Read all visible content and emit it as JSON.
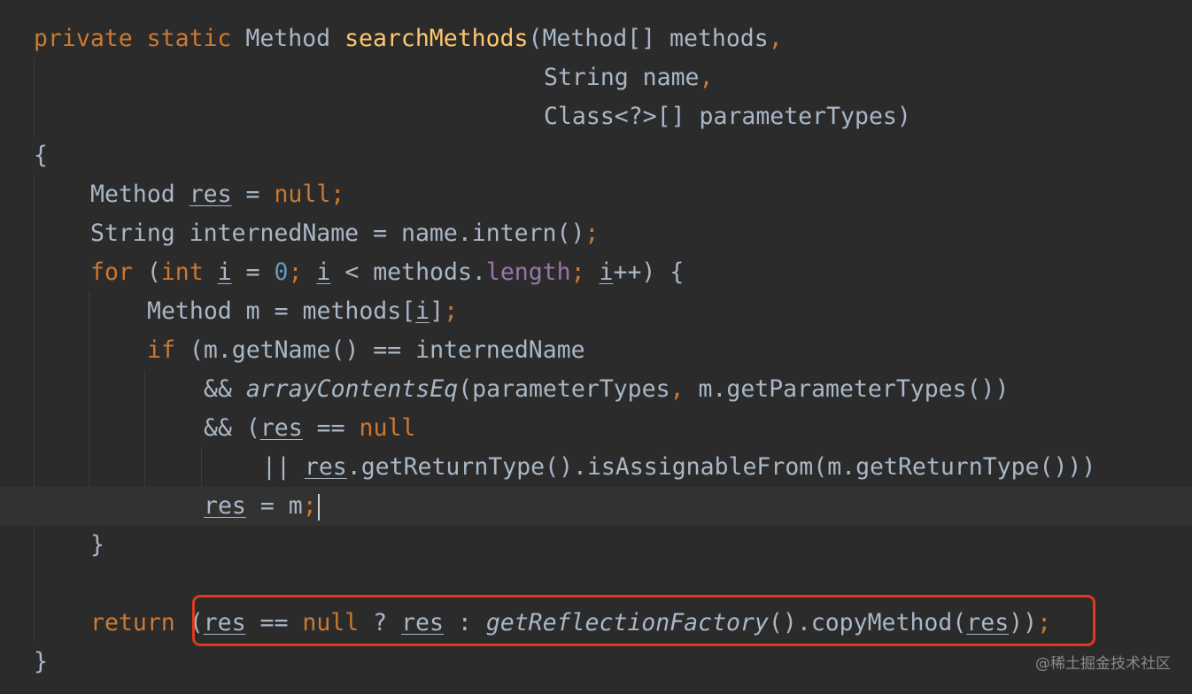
{
  "editor": {
    "theme_colors": {
      "background": "#2b2b2b",
      "keyword": "#cc7832",
      "method_declaration": "#ffc66d",
      "number": "#6897bb",
      "field": "#9876aa",
      "default_text": "#a9b7c6",
      "highlight_border": "#e0391f"
    },
    "current_line": 13
  },
  "code": {
    "l1": {
      "kw1": "private",
      "kw2": "static",
      "type": "Method",
      "name": "searchMethods",
      "rest": "(Method[] methods",
      "comma": ","
    },
    "l2": {
      "text": "String name",
      "comma": ","
    },
    "l3": {
      "text": "Class<?>[] parameterTypes)"
    },
    "l4": {
      "brace": "{"
    },
    "l5": {
      "type": "Method",
      "var": "res",
      "eq": " = ",
      "kw": "null",
      "semi": ";"
    },
    "l6": {
      "text": "String internedName = name.intern()",
      "semi": ";"
    },
    "l7": {
      "kw_for": "for",
      "p1": " (",
      "kw_int": "int",
      "sp": " ",
      "i1": "i",
      "eq0": " = ",
      "zero": "0",
      "semi1": ";",
      "sp2": " ",
      "i2": "i",
      "lt": " < methods.",
      "length": "length",
      "semi2": ";",
      "sp3": " ",
      "i3": "i",
      "rest": "++) {"
    },
    "l8": {
      "pre": "Method m = methods[",
      "i": "i",
      "post": "]",
      "semi": ";"
    },
    "l9": {
      "kw_if": "if",
      "rest": " (m.getName() == internedName"
    },
    "l10": {
      "amp": "&& ",
      "call": "arrayContentsEq",
      "args1": "(parameterTypes",
      "comma": ",",
      "args2": " m.getParameterTypes())"
    },
    "l11": {
      "amp": "&& (",
      "res": "res",
      "eq": " == ",
      "kw": "null"
    },
    "l12": {
      "or": "|| ",
      "res": "res",
      "rest": ".getReturnType().isAssignableFrom(m.getReturnType()))"
    },
    "l13": {
      "res": "res",
      "rest": " = m",
      "semi": ";"
    },
    "l14": {
      "brace": "}"
    },
    "l15": {
      "kw_return": "return",
      "sp": " (",
      "res1": "res",
      "eq": " == ",
      "kw_null": "null",
      "q": " ? ",
      "res2": "res",
      "colon": " : ",
      "call": "getReflectionFactory",
      "mid": "().copyMethod(",
      "res3": "res",
      "end": "))",
      "semi": ";"
    },
    "l16": {
      "brace": "}"
    }
  },
  "watermark": {
    "text": "@稀土掘金技术社区"
  }
}
